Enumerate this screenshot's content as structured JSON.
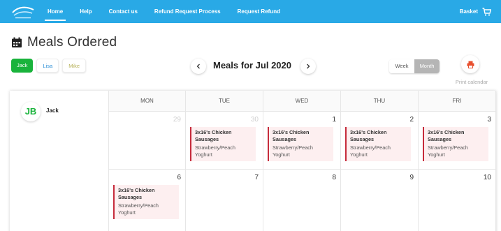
{
  "nav": {
    "items": [
      {
        "label": "Home",
        "active": true
      },
      {
        "label": "Help",
        "active": false
      },
      {
        "label": "Contact us",
        "active": false
      },
      {
        "label": "Refund Request Process",
        "active": false
      },
      {
        "label": "Request Refund",
        "active": false
      }
    ],
    "basket_label": "Basket",
    "basket_icon": "shopping-cart-icon",
    "logo_icon": "school-logo-icon"
  },
  "header": {
    "title": "Meals Ordered",
    "title_icon": "calendar-icon"
  },
  "children": [
    {
      "name": "Jack",
      "selected": true
    },
    {
      "name": "Lisa",
      "selected": false
    },
    {
      "name": "Mike",
      "selected": false
    }
  ],
  "period": {
    "title": "Meals for Jul 2020",
    "prev_icon": "chevron-left-icon",
    "next_icon": "chevron-right-icon"
  },
  "view_toggle": {
    "week_label": "Week",
    "month_label": "Month",
    "selected": "Month"
  },
  "print": {
    "label": "Print calendar",
    "icon": "printer-icon"
  },
  "calendar": {
    "child": {
      "initials": "JB",
      "name": "Jack"
    },
    "days": [
      "MON",
      "TUE",
      "WED",
      "THU",
      "FRI"
    ],
    "weeks": [
      [
        {
          "date": "29",
          "muted": true,
          "meal": null
        },
        {
          "date": "30",
          "muted": true,
          "meal": {
            "main": "3x16's Chicken Sausages",
            "side": "Strawberry/Peach Yoghurt"
          }
        },
        {
          "date": "1",
          "muted": false,
          "meal": {
            "main": "3x16's Chicken Sausages",
            "side": "Strawberry/Peach Yoghurt"
          }
        },
        {
          "date": "2",
          "muted": false,
          "meal": {
            "main": "3x16's Chicken Sausages",
            "side": "Strawberry/Peach Yoghurt"
          }
        },
        {
          "date": "3",
          "muted": false,
          "meal": {
            "main": "3x16's Chicken Sausages",
            "side": "Strawberry/Peach Yoghurt"
          }
        }
      ],
      [
        {
          "date": "6",
          "muted": false,
          "meal": {
            "main": "3x16's Chicken Sausages",
            "side": "Strawberry/Peach Yoghurt"
          }
        },
        {
          "date": "7",
          "muted": false,
          "meal": null
        },
        {
          "date": "8",
          "muted": false,
          "meal": null
        },
        {
          "date": "9",
          "muted": false,
          "meal": null
        },
        {
          "date": "10",
          "muted": false,
          "meal": null
        }
      ]
    ]
  },
  "colors": {
    "nav_bg": "#29a9e6",
    "selected_child": "#19b33b",
    "meal_accent": "#c62b3b",
    "meal_bg": "#fdeff0"
  }
}
